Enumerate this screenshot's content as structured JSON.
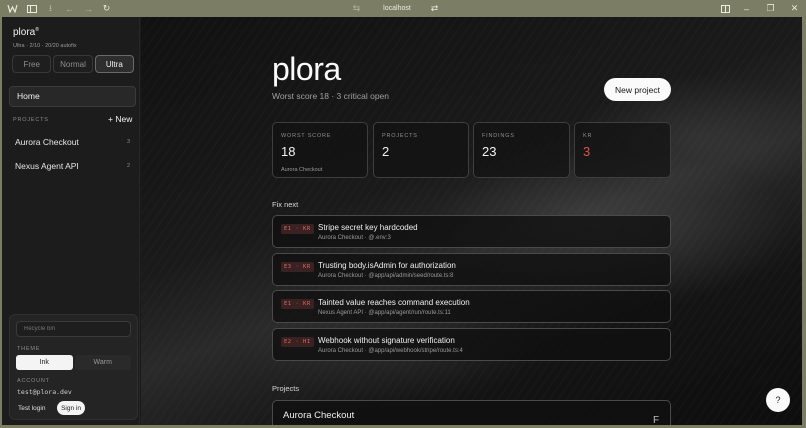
{
  "browser": {
    "url": "localhost",
    "icons": [
      "app-logo-icon",
      "sidebar-toggle-icon",
      "download-icon",
      "back-icon",
      "forward-icon",
      "reload-icon",
      "site-settings-icon",
      "share-icon",
      "reader-icon",
      "minimize-icon",
      "maximize-icon",
      "close-icon"
    ]
  },
  "sidebar": {
    "brand": "plora",
    "brand_mark": "®",
    "plan_line": "Ultra · 2/10 · 20/20 autofix",
    "tiers": [
      {
        "label": "Free",
        "active": false
      },
      {
        "label": "Normal",
        "active": false
      },
      {
        "label": "Ultra",
        "active": true
      }
    ],
    "home_label": "Home",
    "projects_heading": "PROJECTS",
    "new_label": "+ New",
    "projects": [
      {
        "name": "Aurora Checkout",
        "count": "3"
      },
      {
        "name": "Nexus Agent API",
        "count": "2"
      }
    ],
    "recycle_placeholder": "Recycle bin",
    "theme_label": "THEME",
    "themes": [
      {
        "label": "Ink",
        "active": true
      },
      {
        "label": "Warm",
        "active": false
      }
    ],
    "account_label": "ACCOUNT",
    "account_email": "test@plora.dev",
    "test_login_label": "Test login",
    "sign_in_label": "Sign in"
  },
  "main": {
    "title": "plora",
    "subtitle": "Worst score 18 · 3 critical open",
    "new_project_label": "New project",
    "stats": [
      {
        "label": "WORST SCORE",
        "value": "18",
        "note": "Aurora Checkout",
        "color": "#f2f2f2"
      },
      {
        "label": "PROJECTS",
        "value": "2",
        "note": "",
        "color": "#f2f2f2"
      },
      {
        "label": "FINDINGS",
        "value": "23",
        "note": "",
        "color": "#f2f2f2"
      },
      {
        "label": "KR",
        "value": "3",
        "note": "",
        "color": "#e0534f"
      }
    ],
    "fix_next_heading": "Fix next",
    "fix_items": [
      {
        "badge": "E1 · KR",
        "title": "Stripe secret key hardcoded",
        "sub": "Aurora Checkout · @.env:3"
      },
      {
        "badge": "E3 · KR",
        "title": "Trusting body.isAdmin for authorization",
        "sub": "Aurora Checkout · @app/api/admin/seed/route.ts:8"
      },
      {
        "badge": "E1 · KR",
        "title": "Tainted value reaches command execution",
        "sub": "Nexus Agent API · @app/api/agent/run/route.ts:11"
      },
      {
        "badge": "E2 · HI",
        "title": "Webhook without signature verification",
        "sub": "Aurora Checkout · @app/api/webhook/stripe/route.ts:4"
      }
    ],
    "projects_heading": "Projects",
    "project_cards": [
      {
        "name": "Aurora Checkout",
        "grade": "F"
      }
    ],
    "help_label": "?"
  }
}
